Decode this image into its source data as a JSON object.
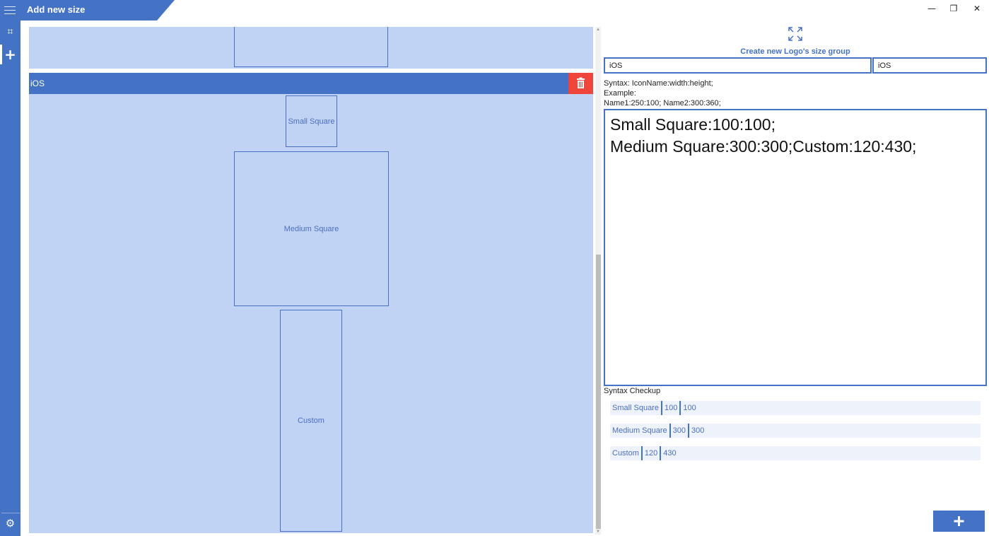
{
  "window": {
    "title": "Add new size",
    "minimize_glyph": "—",
    "restore_glyph": "❐",
    "close_glyph": "✕"
  },
  "rail": {
    "items": [
      {
        "name": "crop-icon",
        "glyph": "⌗"
      },
      {
        "name": "add-icon",
        "glyph": "+"
      },
      {
        "name": "gear-icon",
        "glyph": "⚙"
      }
    ]
  },
  "preview": {
    "group_name": "iOS",
    "sizes": [
      {
        "name": "Small Square",
        "width": 100,
        "height": 100
      },
      {
        "name": "Medium Square",
        "width": 300,
        "height": 300
      },
      {
        "name": "Custom",
        "width": 120,
        "height": 430
      }
    ]
  },
  "form": {
    "create_group_label": "Create new Logo's size group",
    "group_name_value": "iOS",
    "group_id_value": "iOS",
    "syntax_line": "Syntax: IconName:width:height;",
    "example_label": "Example:",
    "example_value": "Name1:250:100; Name2:300:360;",
    "editor_value": "Small Square:100:100;\nMedium Square:300:300;Custom:120:430;",
    "checkup_title": "Syntax Checkup"
  },
  "checkup": [
    {
      "name": "Small Square",
      "width": "100",
      "height": "100"
    },
    {
      "name": "Medium Square",
      "width": "300",
      "height": "300"
    },
    {
      "name": "Custom",
      "width": "120",
      "height": "430"
    }
  ],
  "colors": {
    "accent": "#4472c4",
    "preview_bg": "#c1d3f4",
    "delete": "#f0453a"
  }
}
